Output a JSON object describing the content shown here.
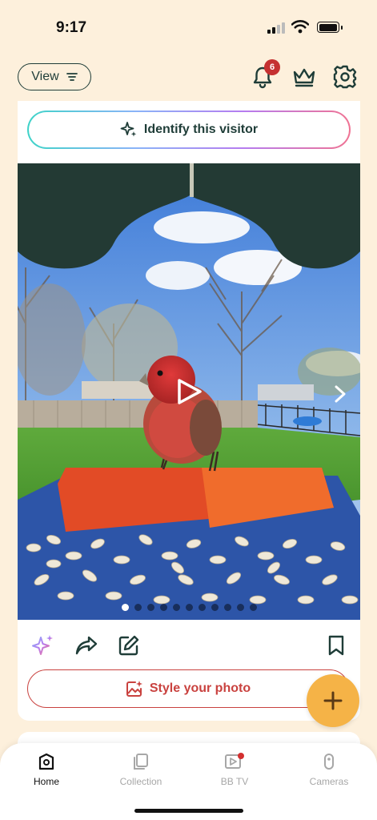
{
  "status": {
    "time": "9:17"
  },
  "header": {
    "view_label": "View",
    "notification_count": "6"
  },
  "card": {
    "identify_label": "Identify this visitor",
    "carousel": {
      "count": 11,
      "active_index": 0
    },
    "style_label": "Style your photo"
  },
  "tabs": [
    {
      "label": "Home",
      "icon": "home-icon",
      "active": true
    },
    {
      "label": "Collection",
      "icon": "collection-icon",
      "active": false
    },
    {
      "label": "BB TV",
      "icon": "tv-icon",
      "active": false
    },
    {
      "label": "Cameras",
      "icon": "camera-icon",
      "active": false
    }
  ],
  "colors": {
    "background": "#fdf0dc",
    "dark_green": "#1f3d38",
    "badge_red": "#c53131",
    "style_red": "#c9423f",
    "fab_yellow": "#f5b347",
    "tv_dot": "#d32f2f"
  }
}
